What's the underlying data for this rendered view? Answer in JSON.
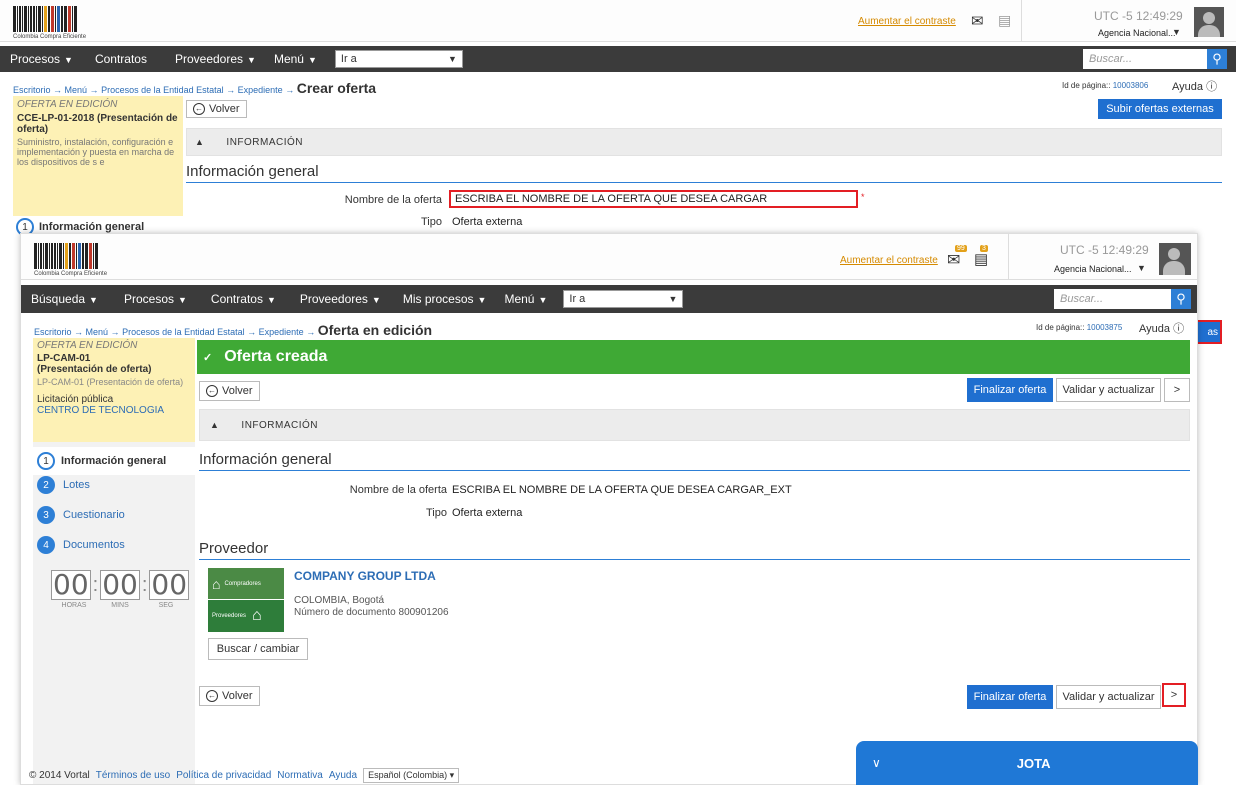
{
  "bg": {
    "logo_text": "Colombia Compra Eficiente",
    "aumentar": "Aumentar el contraste",
    "utc": "UTC -5 12:49:29",
    "agency": "Agencia Nacional...",
    "nav": [
      "Procesos",
      "Contratos",
      "Proveedores",
      "Menú"
    ],
    "ir_a": "Ir a",
    "search_placeholder": "Buscar...",
    "breadcrumb": [
      "Escritorio",
      "Menú",
      "Procesos de la Entidad Estatal",
      "Expediente"
    ],
    "breadcrumb_current": "Crear oferta",
    "page_id_label": "Id de página::",
    "page_id": "10003806",
    "help": "Ayuda",
    "status": "OFERTA EN EDICIÓN",
    "process_title": "CCE-LP-01-2018 (Presentación de oferta)",
    "process_desc": "Suministro, instalación, configuración e implementación y puesta en marcha de los dispositivos de s e",
    "back": "Volver",
    "upload_external": "Subir ofertas externas",
    "info_header": "INFORMACIÓN",
    "section_general": "Información general",
    "offer_name_label": "Nombre de la oferta",
    "offer_name_value": "ESCRIBA EL NOMBRE DE LA OFERTA QUE DESEA CARGAR",
    "type_label": "Tipo",
    "type_value": "Oferta externa",
    "step1": "Información general",
    "edge_text": "as"
  },
  "fg": {
    "logo_text": "Colombia Compra Eficiente",
    "aumentar": "Aumentar el contraste",
    "mail_badge": "99",
    "doc_badge": "3",
    "utc": "UTC -5 12:49:29",
    "agency": "Agencia Nacional...",
    "nav": [
      "Búsqueda",
      "Procesos",
      "Contratos",
      "Proveedores",
      "Mis procesos",
      "Menú"
    ],
    "ir_a": "Ir a",
    "search_placeholder": "Buscar...",
    "breadcrumb": [
      "Escritorio",
      "Menú",
      "Procesos de la Entidad Estatal",
      "Expediente"
    ],
    "breadcrumb_current": "Oferta en edición",
    "page_id_label": "Id de página::",
    "page_id": "10003875",
    "help": "Ayuda",
    "status": "OFERTA EN EDICIÓN",
    "process_code": "LP-CAM-01",
    "process_paren": "(Presentación de oferta)",
    "process_sub": "LP-CAM-01 (Presentación de oferta)",
    "licitacion": "Licitación pública",
    "centro": "CENTRO DE TECNOLOGIA",
    "green_msg": "Oferta creada",
    "back": "Volver",
    "finalize": "Finalizar oferta",
    "validate": "Validar y actualizar",
    "next": ">",
    "info_header": "INFORMACIÓN",
    "section_general": "Información general",
    "offer_name_label": "Nombre de la oferta",
    "offer_name_value": "ESCRIBA EL NOMBRE DE LA OFERTA QUE DESEA CARGAR_EXT",
    "type_label": "Tipo",
    "type_value": "Oferta externa",
    "section_provider": "Proveedor",
    "provider_name": "COMPANY GROUP LTDA",
    "provider_location": "COLOMBIA, Bogotá",
    "provider_doc": "Número de documento 800901206",
    "logo_top": "Compradores",
    "logo_bottom": "Proveedores",
    "search_change": "Buscar / cambiar",
    "steps": [
      {
        "num": "1",
        "label": "Información general"
      },
      {
        "num": "2",
        "label": "Lotes"
      },
      {
        "num": "3",
        "label": "Cuestionario"
      },
      {
        "num": "4",
        "label": "Documentos"
      }
    ],
    "timer": {
      "h": "00",
      "m": "00",
      "s": "00",
      "h_label": "HORAS",
      "m_label": "MINS",
      "s_label": "SEG"
    },
    "footer": {
      "copyright": "© 2014 Vortal",
      "links": [
        "Términos de uso",
        "Política de privacidad",
        "Normativa",
        "Ayuda"
      ],
      "language": "Español (Colombia)"
    },
    "jota": "JOTA"
  },
  "colors": {
    "accent": "#2d7fd6",
    "nav": "#3b3b3b",
    "success": "#3fa935",
    "highlight": "#e31e24",
    "sidebar": "#fdf1b5"
  }
}
